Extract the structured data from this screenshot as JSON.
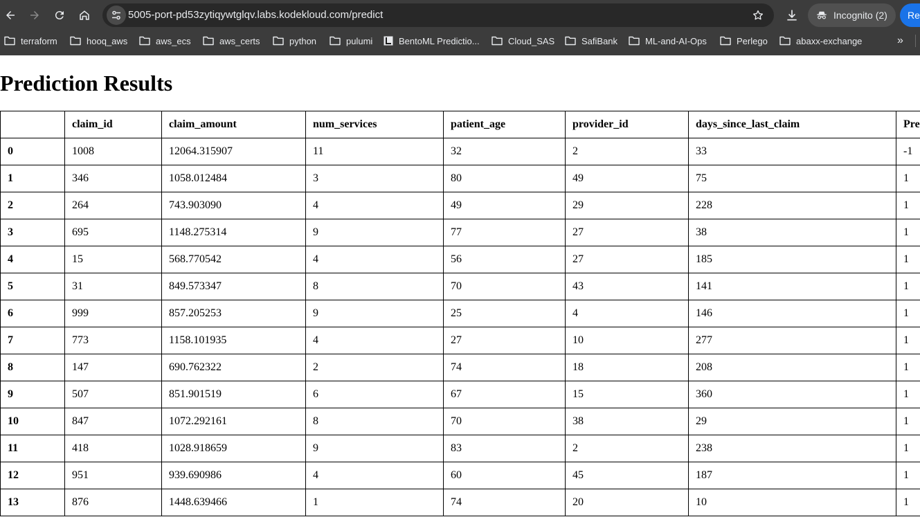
{
  "browser": {
    "url": "5005-port-pd53zytiqywtglqv.labs.kodekloud.com/predict",
    "incognito_label": "Incognito (2)",
    "relaunch_label": "Rel",
    "accent_color": "#1a73e8",
    "bookmarks": [
      {
        "label": "terraform",
        "icon": "folder-icon"
      },
      {
        "label": "hooq_aws",
        "icon": "folder-icon"
      },
      {
        "label": "aws_ecs",
        "icon": "folder-icon"
      },
      {
        "label": "aws_certs",
        "icon": "folder-icon"
      },
      {
        "label": "python",
        "icon": "folder-icon"
      },
      {
        "label": "pulumi",
        "icon": "folder-icon"
      },
      {
        "label": "BentoML Predictio...",
        "icon": "bentoml-favicon"
      },
      {
        "label": "Cloud_SAS",
        "icon": "folder-icon"
      },
      {
        "label": "SafiBank",
        "icon": "folder-icon"
      },
      {
        "label": "ML-and-AI-Ops",
        "icon": "folder-icon"
      },
      {
        "label": "Perlego",
        "icon": "folder-icon"
      },
      {
        "label": "abaxx-exchange",
        "icon": "folder-icon"
      }
    ],
    "more_bookmarks_glyph": "»"
  },
  "page": {
    "title": "Prediction Results",
    "table": {
      "columns": [
        "",
        "claim_id",
        "claim_amount",
        "num_services",
        "patient_age",
        "provider_id",
        "days_since_last_claim",
        "Pre"
      ],
      "rows": [
        [
          "0",
          "1008",
          "12064.315907",
          "11",
          "32",
          "2",
          "33",
          "-1"
        ],
        [
          "1",
          "346",
          "1058.012484",
          "3",
          "80",
          "49",
          "75",
          "1"
        ],
        [
          "2",
          "264",
          "743.903090",
          "4",
          "49",
          "29",
          "228",
          "1"
        ],
        [
          "3",
          "695",
          "1148.275314",
          "9",
          "77",
          "27",
          "38",
          "1"
        ],
        [
          "4",
          "15",
          "568.770542",
          "4",
          "56",
          "27",
          "185",
          "1"
        ],
        [
          "5",
          "31",
          "849.573347",
          "8",
          "70",
          "43",
          "141",
          "1"
        ],
        [
          "6",
          "999",
          "857.205253",
          "9",
          "25",
          "4",
          "146",
          "1"
        ],
        [
          "7",
          "773",
          "1158.101935",
          "4",
          "27",
          "10",
          "277",
          "1"
        ],
        [
          "8",
          "147",
          "690.762322",
          "2",
          "74",
          "18",
          "208",
          "1"
        ],
        [
          "9",
          "507",
          "851.901519",
          "6",
          "67",
          "15",
          "360",
          "1"
        ],
        [
          "10",
          "847",
          "1072.292161",
          "8",
          "70",
          "38",
          "29",
          "1"
        ],
        [
          "11",
          "418",
          "1028.918659",
          "9",
          "83",
          "2",
          "238",
          "1"
        ],
        [
          "12",
          "951",
          "939.690986",
          "4",
          "60",
          "45",
          "187",
          "1"
        ],
        [
          "13",
          "876",
          "1448.639466",
          "1",
          "74",
          "20",
          "10",
          "1"
        ]
      ]
    }
  }
}
